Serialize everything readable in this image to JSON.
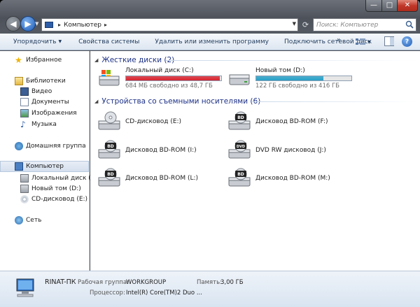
{
  "window": {
    "controls": {
      "minimize": "—",
      "maximize": "□",
      "close": "✕"
    },
    "nav": {
      "back_icon": "back-arrow-icon",
      "forward_icon": "forward-arrow-icon"
    },
    "address": {
      "item": "Компьютер",
      "separator": "▸"
    },
    "search": {
      "placeholder": "Поиск: Компьютер"
    }
  },
  "toolbar": {
    "organize": "Упорядочить",
    "properties": "Свойства системы",
    "uninstall": "Удалить или изменить программу",
    "map_drive": "Подключить сетевой диск",
    "more": "»",
    "help": "?"
  },
  "sidebar": {
    "favorites": "Избранное",
    "libraries": "Библиотеки",
    "video": "Видео",
    "documents": "Документы",
    "images": "Изображения",
    "music": "Музыка",
    "homegroup": "Домашняя группа",
    "computer": "Компьютер",
    "drive_c": "Локальный диск (C:)",
    "drive_d": "Новый том (D:)",
    "drive_e": "CD-дисковод (E:)",
    "network": "Сеть"
  },
  "main": {
    "hard_drives_header": "Жесткие диски (2)",
    "removable_header": "Устройства со съемными носителями (6)",
    "hard_drives": [
      {
        "name": "Локальный диск (C:)",
        "free": "684 МБ свободно из 48,7 ГБ",
        "used_fraction": 0.986,
        "bar_color": "#d9232e"
      },
      {
        "name": "Новый том (D:)",
        "free": "122 ГБ свободно из 416 ГБ",
        "used_fraction": 0.707,
        "bar_color": "#26a0c8"
      }
    ],
    "removable": [
      {
        "name": "CD-дисковод (E:)",
        "label": ""
      },
      {
        "name": "Дисковод BD-ROM (F:)",
        "label": "BD"
      },
      {
        "name": "Дисковод BD-ROM (I:)",
        "label": "BD"
      },
      {
        "name": "DVD RW дисковод (J:)",
        "label": "DVD"
      },
      {
        "name": "Дисковод BD-ROM (L:)",
        "label": "BD"
      },
      {
        "name": "Дисковод BD-ROM (M:)",
        "label": "BD"
      }
    ]
  },
  "status": {
    "pc_name": "RINAT-ПК",
    "workgroup_label": "Рабочая группа:",
    "workgroup": "WORKGROUP",
    "memory_label": "Память:",
    "memory": "3,00 ГБ",
    "cpu_label": "Процессор:",
    "cpu": "Intel(R) Core(TM)2 Duo ..."
  }
}
